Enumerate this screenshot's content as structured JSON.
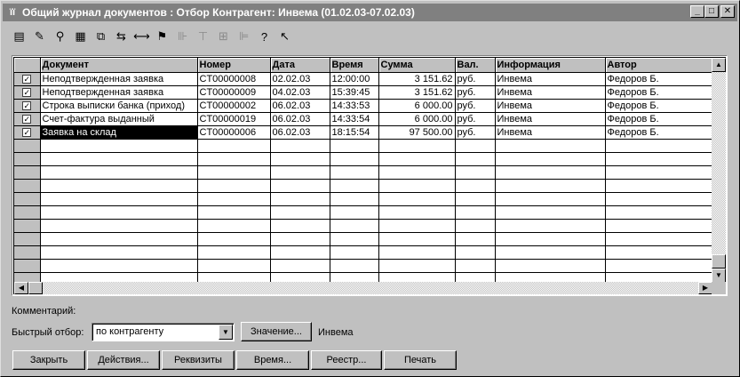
{
  "window": {
    "title": "Общий журнал документов : Отбор Контрагент: Инвема (01.02.03-07.02.03)",
    "app_icon_glyph": "ïï",
    "minimize_glyph": "_",
    "maximize_glyph": "□",
    "close_glyph": "✕"
  },
  "toolbar": {
    "icons": [
      {
        "name": "new-icon",
        "glyph": "▤",
        "disabled": false
      },
      {
        "name": "edit-icon",
        "glyph": "✎",
        "disabled": false
      },
      {
        "name": "find-icon",
        "glyph": "⚲",
        "disabled": false
      },
      {
        "name": "print-icon",
        "glyph": "▦",
        "disabled": false
      },
      {
        "name": "copy-icon",
        "glyph": "⧉",
        "disabled": false
      },
      {
        "name": "move-icon",
        "glyph": "⇆",
        "disabled": false
      },
      {
        "name": "interval-icon",
        "glyph": "⟷",
        "disabled": false
      },
      {
        "name": "filter-icon",
        "glyph": "⚑",
        "disabled": false
      },
      {
        "name": "tree-icon",
        "glyph": "⊪",
        "disabled": true
      },
      {
        "name": "hierarchy-icon",
        "glyph": "⊤",
        "disabled": true
      },
      {
        "name": "group-icon",
        "glyph": "⊞",
        "disabled": true
      },
      {
        "name": "subordinate-icon",
        "glyph": "⊫",
        "disabled": true
      },
      {
        "name": "help-icon",
        "glyph": "?",
        "disabled": false
      },
      {
        "name": "context-help-icon",
        "glyph": "↖",
        "disabled": false
      }
    ]
  },
  "grid": {
    "columns": [
      "",
      "Документ",
      "Номер",
      "Дата",
      "Время",
      "Сумма",
      "Вал.",
      "Информация",
      "Автор"
    ],
    "rows": [
      {
        "doc": "Неподтвержденная заявка",
        "num": "CT00000008",
        "date": "02.02.03",
        "time": "12:00:00",
        "sum": "3 151.62",
        "cur": "руб.",
        "info": "Инвема",
        "author": "Федоров Б."
      },
      {
        "doc": "Неподтвержденная заявка",
        "num": "CT00000009",
        "date": "04.02.03",
        "time": "15:39:45",
        "sum": "3 151.62",
        "cur": "руб.",
        "info": "Инвема",
        "author": "Федоров Б."
      },
      {
        "doc": "Строка выписки банка (приход)",
        "num": "CT00000002",
        "date": "06.02.03",
        "time": "14:33:53",
        "sum": "6 000.00",
        "cur": "руб.",
        "info": "Инвема",
        "author": "Федоров Б."
      },
      {
        "doc": "Счет-фактура выданный",
        "num": "CT00000019",
        "date": "06.02.03",
        "time": "14:33:54",
        "sum": "6 000.00",
        "cur": "руб.",
        "info": "Инвема",
        "author": "Федоров Б."
      },
      {
        "doc": "Заявка на склад",
        "num": "CT00000006",
        "date": "06.02.03",
        "time": "18:15:54",
        "sum": "97 500.00",
        "cur": "руб.",
        "info": "Инвема",
        "author": "Федоров Б."
      }
    ],
    "selected_row": 4,
    "check_glyph": "✓",
    "scroll_up_glyph": "▲",
    "scroll_down_glyph": "▼",
    "scroll_left_glyph": "◀",
    "scroll_right_glyph": "▶"
  },
  "footer": {
    "comment_label": "Комментарий:",
    "quick_filter_label": "Быстрый отбор:",
    "filter_value": "по контрагенту",
    "combo_glyph": "▼",
    "value_button": "Значение...",
    "value_text": "Инвема"
  },
  "buttons": {
    "close": "Закрыть",
    "actions": "Действия...",
    "requisites": "Реквизиты",
    "time": "Время...",
    "register": "Реестр...",
    "print": "Печать"
  }
}
